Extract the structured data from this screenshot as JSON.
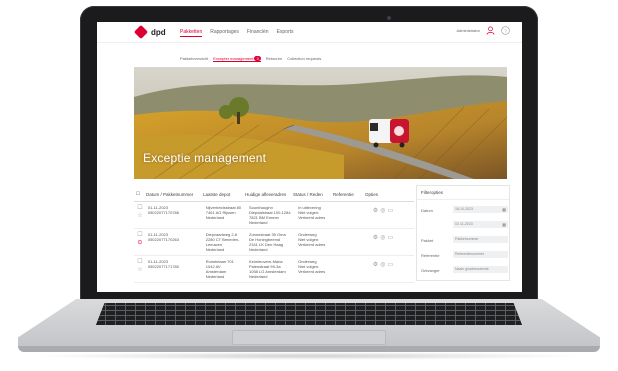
{
  "app": {
    "logo_text": "dpd"
  },
  "nav": {
    "main": [
      "Pakketten",
      "Rapportages",
      "Financiën",
      "Exports"
    ],
    "user": "Administrator"
  },
  "subnav": {
    "items": [
      "Pakketoverzicht",
      "Excepter management",
      "Retouren",
      "Collection requests"
    ],
    "badge": "3"
  },
  "hero": {
    "title": "Exceptie management"
  },
  "table": {
    "headers": [
      "Datum / Pakketnummer",
      "Laatste depot",
      "Huidige afleveradres",
      "Status / Reden",
      "Referentie",
      "Opties"
    ],
    "rows": [
      {
        "date": "01-11-2023",
        "number": "05022077170786",
        "depot": "Nijverheidsstraat 80\n7461 AG Rijssen\nNederland",
        "address": "Sounthaughn\nDiepdalstraat 100-1284\n7821 BM Emmer\nNederland",
        "status": "In uitlevering\nNiet volgen: Verkeerd adres"
      },
      {
        "date": "01-11-2023",
        "number": "05022077170263",
        "depot": "Diepvaartweg 2-6\n2280 CT Beneden-Leeuwen\nNederland",
        "address": "Zonnestraat 39 Oma\nDe Honingbeemd\n2341 LK Den Haag\nNederland",
        "status": "Onderweg\nNiet volgen: Verkeerd adres"
      },
      {
        "date": "01-11-2023",
        "number": "05022077171780",
        "depot": "Ruimtelaan 701\n1042 AV\nAmsterdam\nNederland",
        "address": "Keimleuvern-Maria\nPalenstraat 59-3a\n1058 LG Amsterdam\nNederland",
        "status": "Onderweg\nNiet volgen: Verkeerd adres"
      }
    ]
  },
  "filter": {
    "title": "Filteropties",
    "date_label": "Datum",
    "date_from": "18-10-2023",
    "date_to": "02-11-2023",
    "parcel_label": "Pakket",
    "parcel_placeholder": "Pakketnummer",
    "reference_label": "Referentie",
    "reference_placeholder": "Referentienummer",
    "delivery_label": "Ontvanger",
    "delivery_placeholder": "Naam geadresseerde"
  }
}
